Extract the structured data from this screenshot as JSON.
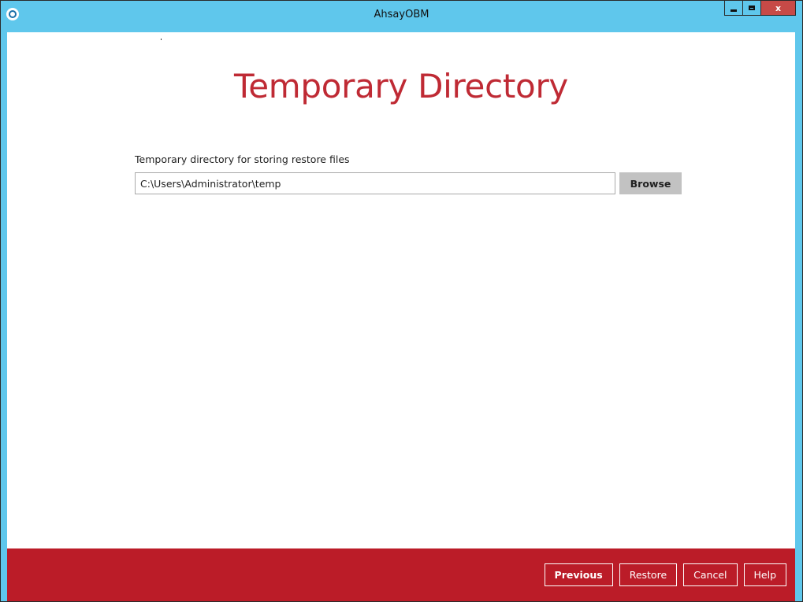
{
  "window": {
    "title": "AhsayOBM",
    "controls": {
      "minimize_icon": "minimize-icon",
      "maximize_icon": "maximize-icon",
      "close_label": "x"
    }
  },
  "page": {
    "title": "Temporary Directory",
    "field_label": "Temporary directory for storing restore files",
    "directory_value": "C:\\Users\\Administrator\\temp",
    "browse_label": "Browse"
  },
  "footer": {
    "previous_label": "Previous",
    "restore_label": "Restore",
    "cancel_label": "Cancel",
    "help_label": "Help"
  },
  "colors": {
    "titlebar": "#5fc7ec",
    "accent": "#bf2a34",
    "footer": "#bb1c28",
    "browse_button": "#c2c2c2"
  }
}
